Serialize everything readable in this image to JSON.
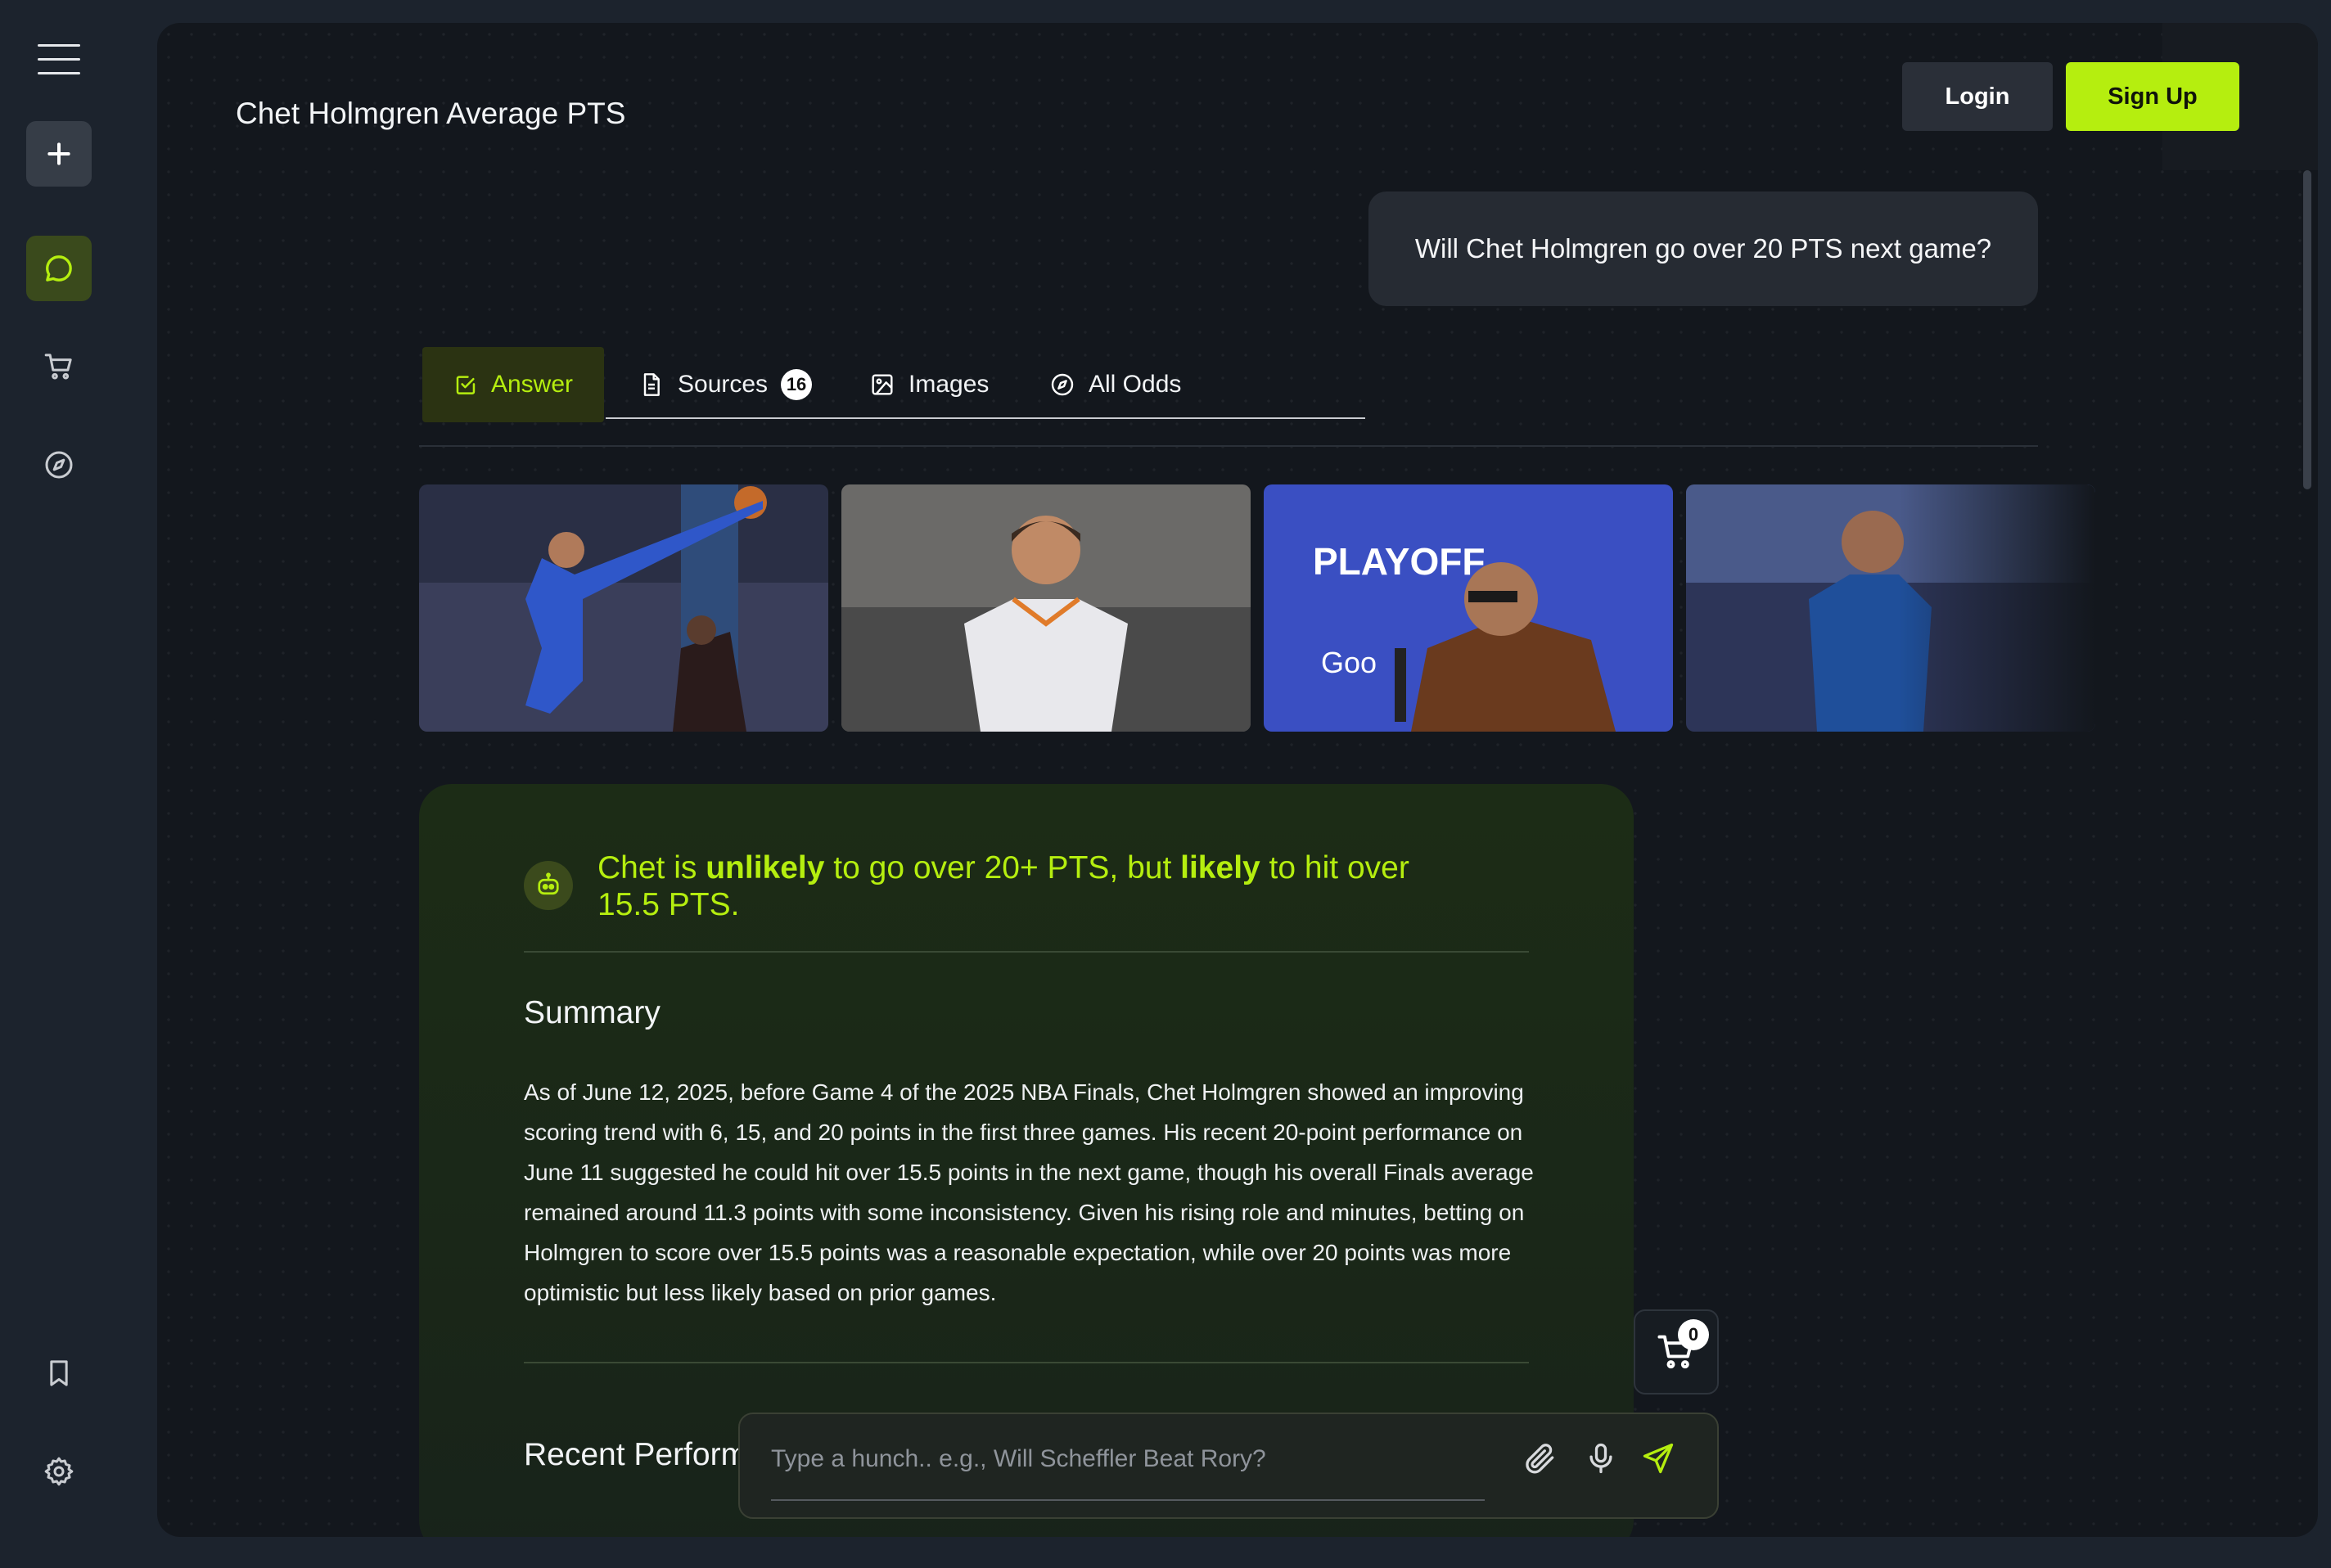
{
  "header": {
    "page_title": "Chet Holmgren Average PTS",
    "login_label": "Login",
    "signup_label": "Sign Up"
  },
  "sidebar": {
    "items": [
      {
        "icon": "menu-icon"
      },
      {
        "icon": "plus-icon"
      },
      {
        "icon": "chat-icon",
        "active": true
      },
      {
        "icon": "cart-icon"
      },
      {
        "icon": "compass-icon"
      },
      {
        "icon": "bookmark-icon"
      },
      {
        "icon": "settings-icon"
      }
    ]
  },
  "conversation": {
    "user_question": "Will Chet Holmgren go over 20 PTS next game?"
  },
  "tabs": [
    {
      "label": "Answer",
      "icon": "check-square-icon",
      "active": true
    },
    {
      "label": "Sources",
      "icon": "document-icon",
      "count": "16"
    },
    {
      "label": "Images",
      "icon": "image-icon"
    },
    {
      "label": "All Odds",
      "icon": "compass-icon"
    }
  ],
  "images": [
    {
      "alt": "Thunder player #7 blocking a shot"
    },
    {
      "alt": "Oklahoma City player #7 on court"
    },
    {
      "alt": "Player at playoffs press conference"
    },
    {
      "alt": "Thunder player #7 celebrating"
    }
  ],
  "answer": {
    "verdict_prefix": "Chet is ",
    "verdict_strong1": "unlikely",
    "verdict_mid": " to go over 20+ PTS, but ",
    "verdict_strong2": "likely",
    "verdict_suffix": " to hit over 15.5 PTS.",
    "summary_heading": "Summary",
    "summary_text": "As of June 12, 2025, before Game 4 of the 2025 NBA Finals, Chet Holmgren showed an improving scoring trend with 6, 15, and 20 points in the first three games. His recent 20-point performance on June 11 suggested he could hit over 15.5 points in the next game, though his overall Finals average remained around 11.3 points with some inconsistency. Given his rising role and minutes, betting on Holmgren to score over 15.5 points was a reasonable expectation, while over 20 points was more optimistic but less likely based on prior games.",
    "recent_heading": "Recent Perform"
  },
  "cart": {
    "count": "0"
  },
  "input": {
    "placeholder": "Type a hunch.. e.g., Will Scheffler Beat Rory?",
    "value": ""
  },
  "colors": {
    "accent": "#b5ee0f",
    "background": "#1c232d",
    "panel": "#13171d",
    "card": "#1c2c16"
  }
}
